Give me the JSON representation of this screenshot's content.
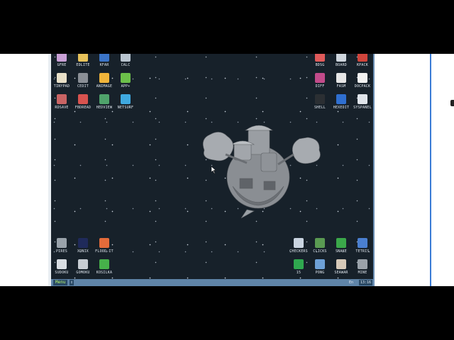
{
  "desktop": {
    "icons_top_left": [
      {
        "label": "GFRE",
        "icon": "gfre-icon",
        "color": "#c9a0d6"
      },
      {
        "label": "EDLITE",
        "icon": "edlite-icon",
        "color": "#e7c25a"
      },
      {
        "label": "KFAR",
        "icon": "kfar-icon",
        "color": "#3b74c8"
      },
      {
        "label": "CALC",
        "icon": "calc-icon",
        "color": "#b9c4cf"
      },
      {
        "label": "TINYPAD",
        "icon": "tinypad-icon",
        "color": "#e8e0c8"
      },
      {
        "label": "CEDIT",
        "icon": "cedit-icon",
        "color": "#8a8f96"
      },
      {
        "label": "ANIMAGE",
        "icon": "animage-icon",
        "color": "#f0b43a"
      },
      {
        "label": "APP+",
        "icon": "app-plus-icon",
        "color": "#6cc04a"
      },
      {
        "label": "RDSAVE",
        "icon": "rdsave-icon",
        "color": "#c96464"
      },
      {
        "label": "FBDREAD",
        "icon": "fbdread-icon",
        "color": "#d9534f"
      },
      {
        "label": "HEDVIEW",
        "icon": "hedview-icon",
        "color": "#4fa36b"
      },
      {
        "label": "NETSURF",
        "icon": "netsurf-icon",
        "color": "#3fa9e0"
      }
    ],
    "icons_top_right": [
      {
        "label": "BDSG",
        "icon": "bdsg-icon",
        "color": "#e05a5a"
      },
      {
        "label": "BOARD",
        "icon": "board-icon",
        "color": "#cfd6dd"
      },
      {
        "label": "KPACK",
        "icon": "kpack-icon",
        "color": "#d0453c"
      },
      {
        "label": "DIFF",
        "icon": "diff-icon",
        "color": "#c24b8a"
      },
      {
        "label": "FASM",
        "icon": "fasm-icon",
        "color": "#e6e6e6"
      },
      {
        "label": "DOCPACK",
        "icon": "docpack-icon",
        "color": "#f2f2f2"
      },
      {
        "label": "SHELL",
        "icon": "shell-icon",
        "color": "#2b2f33"
      },
      {
        "label": "HEXEDIT",
        "icon": "hexedit-icon",
        "color": "#2f6fd0"
      },
      {
        "label": "SYSPANEL",
        "icon": "syspanel-icon",
        "color": "#dfe4ea"
      }
    ],
    "icons_bottom_left": [
      {
        "label": "PIRES",
        "icon": "pires-icon",
        "color": "#9aa3ab"
      },
      {
        "label": "XONIX",
        "icon": "xonix-icon",
        "color": "#1f2a5a"
      },
      {
        "label": "FLOOD-IT",
        "icon": "flood-it-icon",
        "color": "#e46b3a"
      },
      {
        "label": "SUDOKU",
        "icon": "sudoku-icon",
        "color": "#d8dde2"
      },
      {
        "label": "GOMOKU",
        "icon": "gomoku-icon",
        "color": "#c7cdd3"
      },
      {
        "label": "KOSILKA",
        "icon": "kosilka-icon",
        "color": "#46b04a"
      }
    ],
    "icons_bottom_right": [
      {
        "label": "CHECKERS",
        "icon": "checkers-icon",
        "color": "#c9d4e0"
      },
      {
        "label": "CLICKS",
        "icon": "clicks-icon",
        "color": "#5a9a52"
      },
      {
        "label": "SNAKE",
        "icon": "snake-icon",
        "color": "#3ba84a"
      },
      {
        "label": "TETRIS",
        "icon": "tetris-icon",
        "color": "#4a7fd0"
      },
      {
        "label": "15",
        "icon": "fifteen-icon",
        "color": "#2fa84f"
      },
      {
        "label": "PONG",
        "icon": "pong-icon",
        "color": "#6da0d6"
      },
      {
        "label": "SEAWAR",
        "icon": "seawar-icon",
        "color": "#d6c9b8"
      },
      {
        "label": "MINE",
        "icon": "mine-icon",
        "color": "#9aa2aa"
      }
    ]
  },
  "taskbar": {
    "menu_label": "Menu",
    "arrow_label": "⇕",
    "lang_label": "En",
    "clock_label": "13:16"
  }
}
